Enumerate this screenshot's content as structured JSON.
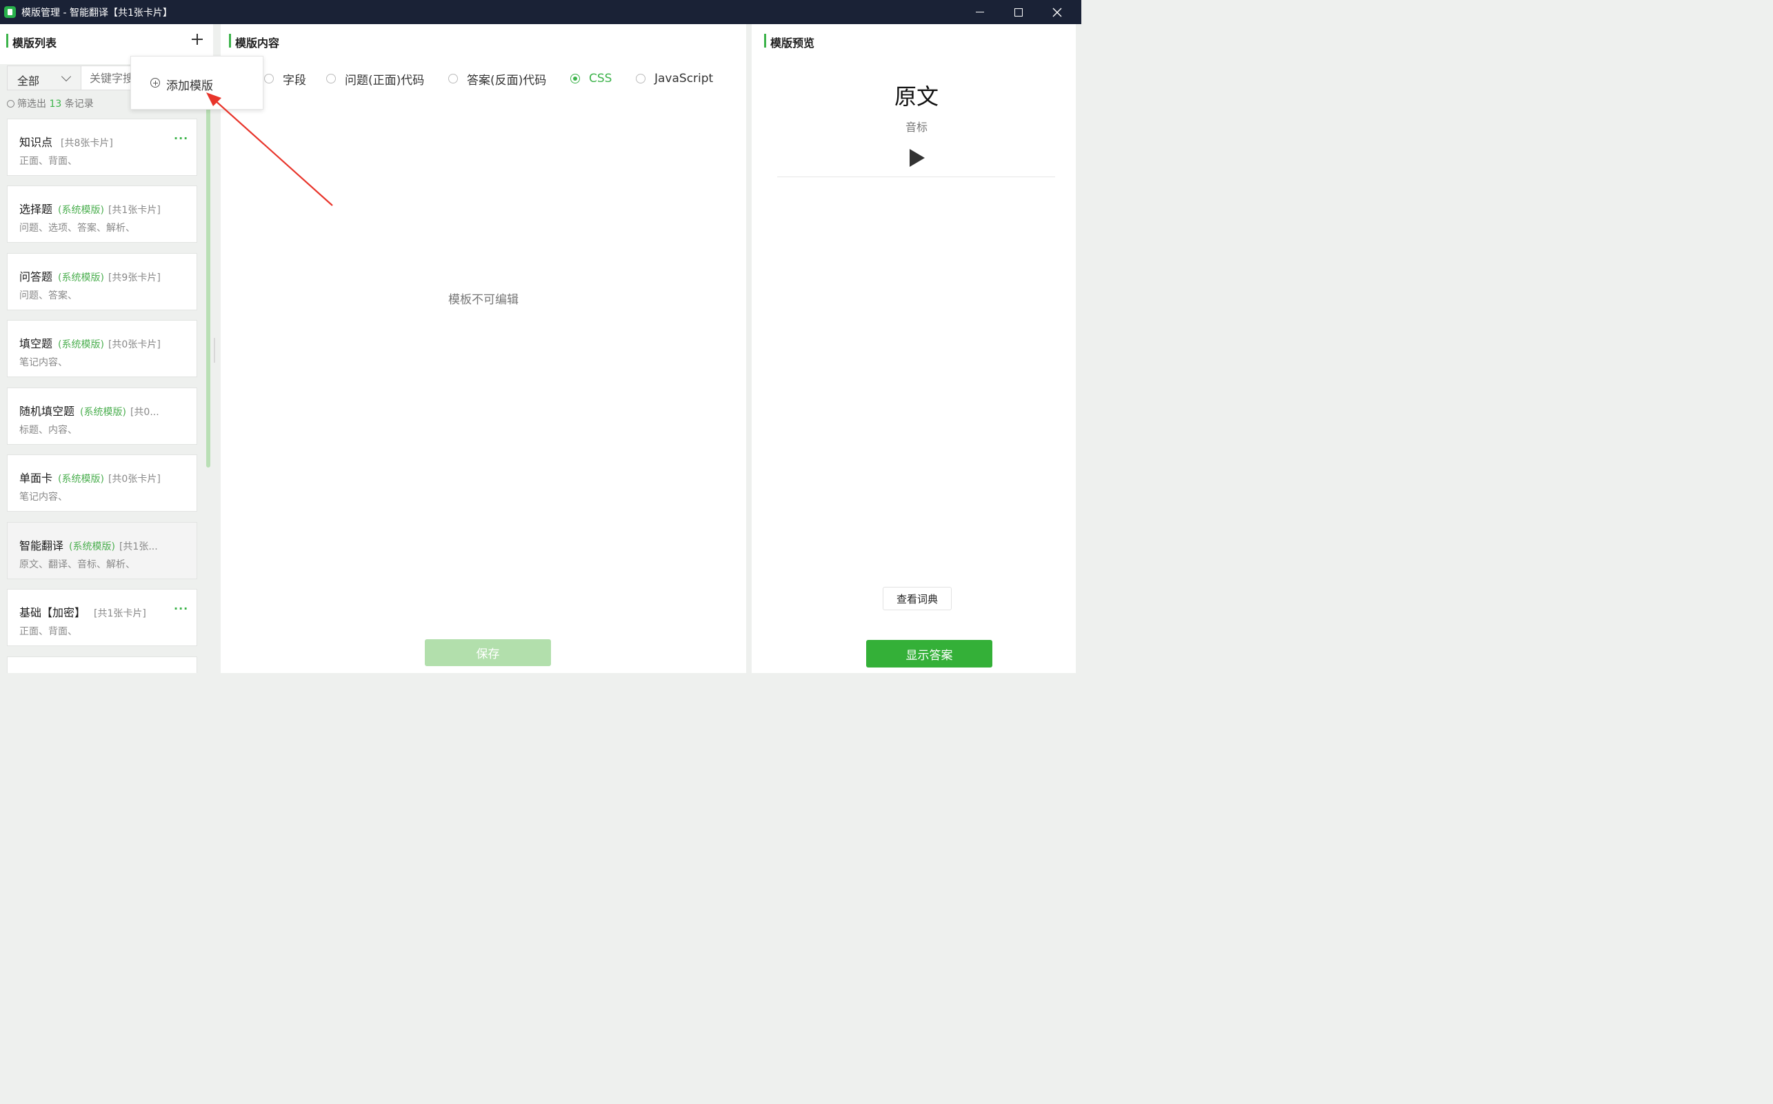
{
  "window": {
    "title": "模版管理 - 智能翻译【共1张卡片】",
    "icons": {
      "minimize": "minimize-icon",
      "maximize": "maximize-icon",
      "close": "close-icon"
    }
  },
  "left_panel": {
    "title": "模版列表",
    "filter": {
      "selected": "全部",
      "search_placeholder": "关键字搜"
    },
    "filter_info": {
      "prefix": "筛选出",
      "count": "13",
      "suffix": "条记录"
    },
    "cards": [
      {
        "name": "知识点",
        "system": "",
        "count": "[共8张卡片]",
        "fields": "正面、背面、",
        "menu": "···"
      },
      {
        "name": "选择题",
        "system": "(系统模版)",
        "count": "[共1张卡片]",
        "fields": "问题、选项、答案、解析、",
        "menu": ""
      },
      {
        "name": "问答题",
        "system": "(系统模版)",
        "count": "[共9张卡片]",
        "fields": "问题、答案、",
        "menu": ""
      },
      {
        "name": "填空题",
        "system": "(系统模版)",
        "count": "[共0张卡片]",
        "fields": "笔记内容、",
        "menu": ""
      },
      {
        "name": "随机填空题",
        "system": "(系统模版)",
        "count": "[共0...",
        "fields": "标题、内容、",
        "menu": ""
      },
      {
        "name": "单面卡",
        "system": "(系统模版)",
        "count": "[共0张卡片]",
        "fields": "笔记内容、",
        "menu": ""
      },
      {
        "name": "智能翻译",
        "system": "(系统模版)",
        "count": "[共1张...",
        "fields": "原文、翻译、音标、解析、",
        "menu": ""
      },
      {
        "name": "基础【加密】",
        "system": "",
        "count": "[共1张卡片]",
        "fields": "正面、背面、",
        "menu": "···"
      }
    ]
  },
  "popup": {
    "label": "添加模版"
  },
  "middle_panel": {
    "title": "模版内容",
    "tabs": [
      {
        "label": "字段",
        "checked": false
      },
      {
        "label": "问题(正面)代码",
        "checked": false
      },
      {
        "label": "答案(反面)代码",
        "checked": false
      },
      {
        "label": "CSS",
        "checked": true
      },
      {
        "label": "JavaScript",
        "checked": false
      }
    ],
    "message": "模板不可编辑",
    "save_label": "保存"
  },
  "right_panel": {
    "title": "模版预览",
    "main_text": "原文",
    "phonetic": "音标",
    "dict_label": "查看词典",
    "show_answer_label": "显示答案"
  },
  "colors": {
    "accent": "#3cb34a",
    "titlebar": "#1a2236",
    "arrow": "#e8352b"
  }
}
